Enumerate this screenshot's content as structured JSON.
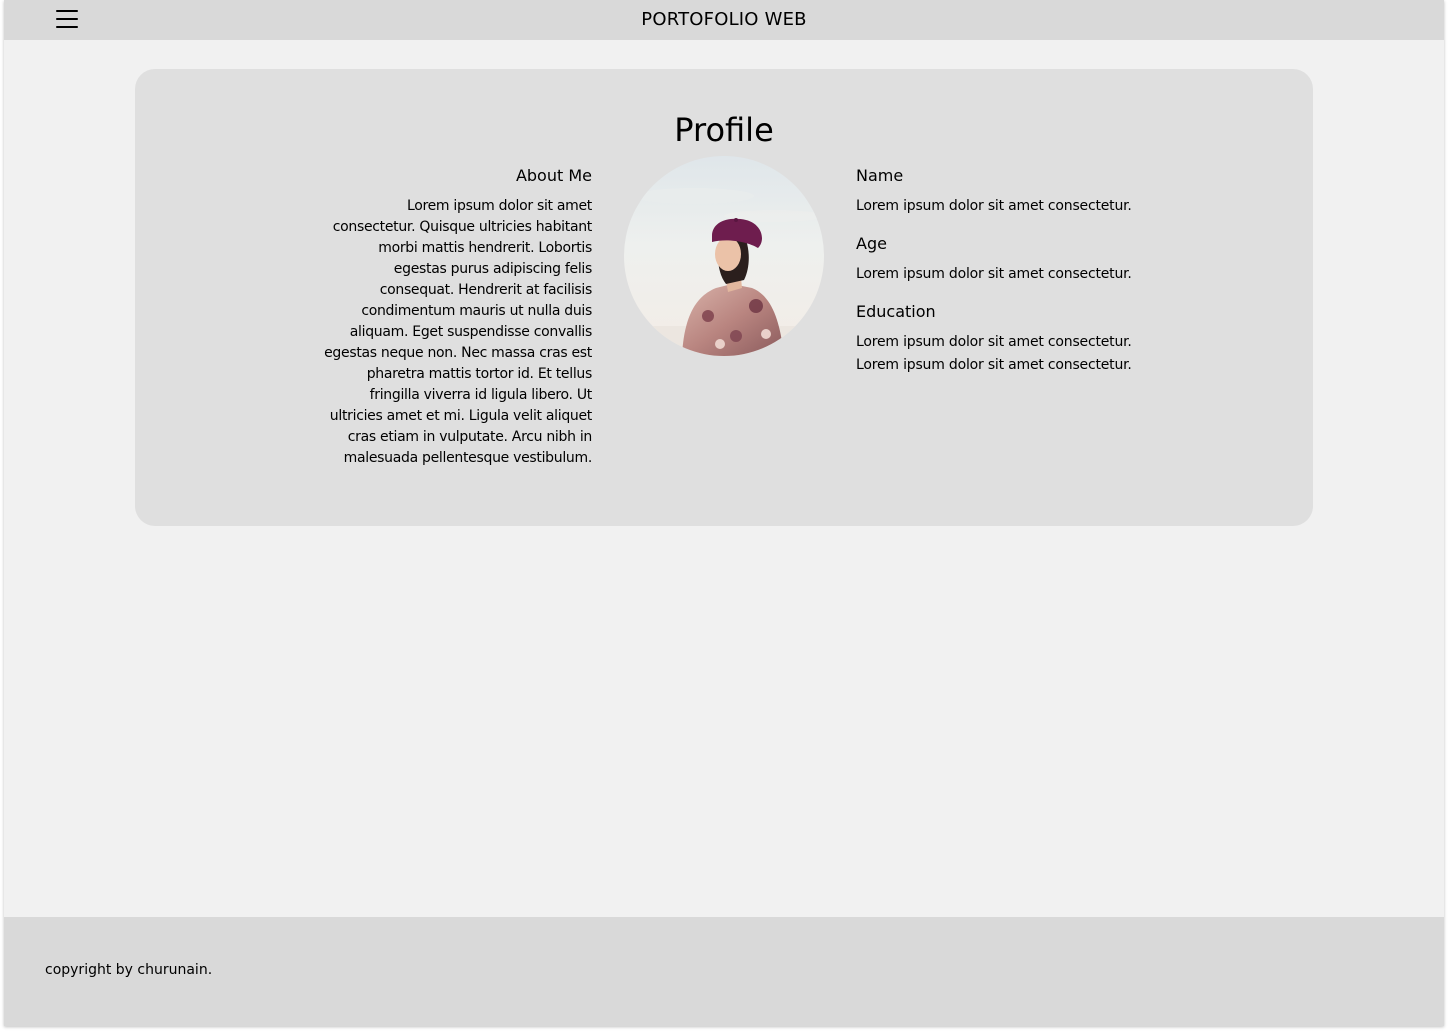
{
  "header": {
    "title": "PORTOFOLIO WEB",
    "menu_icon": "hamburger-menu-icon"
  },
  "profile": {
    "title": "Profile",
    "about": {
      "heading": "About Me",
      "text": "Lorem ipsum dolor sit amet consectetur. Quisque ultricies habitant morbi mattis hendrerit. Lobortis egestas purus adipiscing felis consequat. Hendrerit at facilisis condimentum mauris ut nulla duis aliquam. Eget suspendisse convallis egestas neque non. Nec massa cras est pharetra mattis tortor id. Et tellus fringilla viverra id ligula libero. Ut ultricies amet et mi. Ligula velit aliquet cras etiam in vulputate. Arcu nibh in malesuada pellentesque vestibulum."
    },
    "photo": "profile-photo-woman-in-purple-beret",
    "fields": [
      {
        "label": "Name",
        "value": "Lorem ipsum dolor sit amet consectetur."
      },
      {
        "label": "Age",
        "value": "Lorem ipsum dolor sit amet consectetur."
      },
      {
        "label": "Education",
        "value": "Lorem ipsum dolor sit amet consectetur.",
        "value2": "Lorem ipsum dolor sit amet consectetur."
      }
    ]
  },
  "footer": {
    "copyright": "copyright by churunain."
  },
  "colors": {
    "page_background": "#f1f1f1",
    "bar_background": "#d9d9d9",
    "card_background": "#dfdfdf",
    "text": "#000000"
  }
}
